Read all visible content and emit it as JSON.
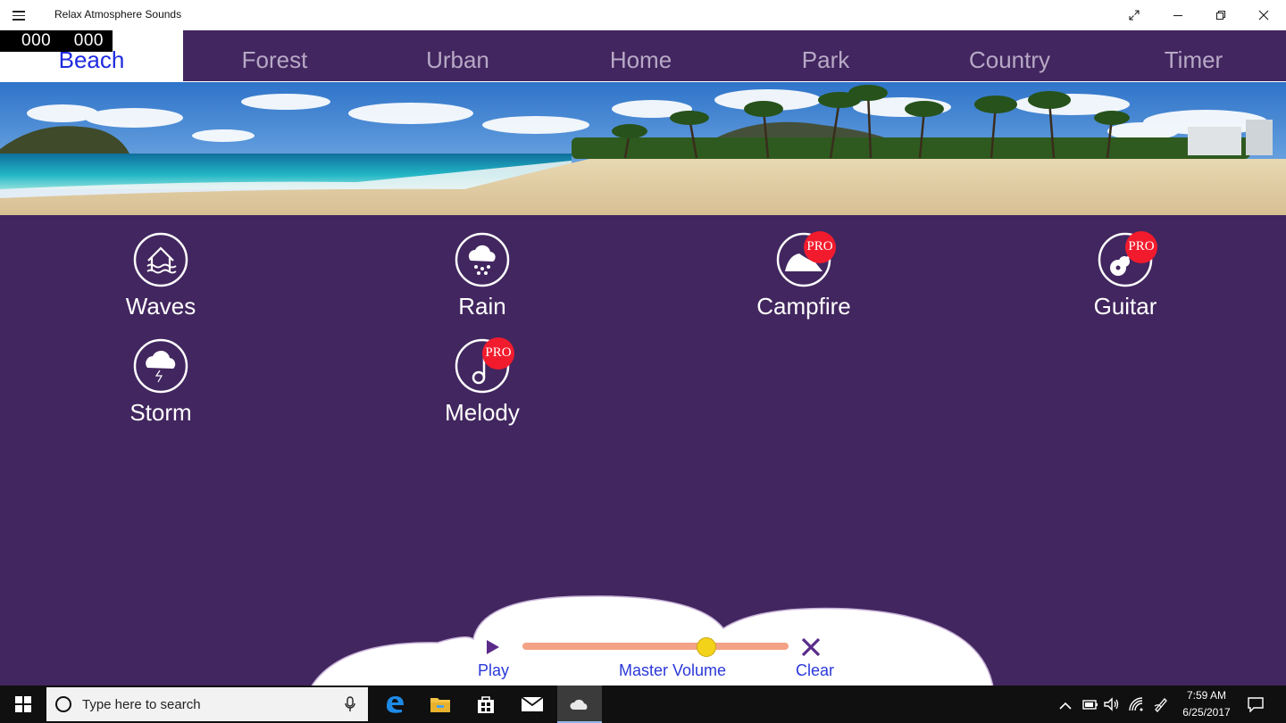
{
  "window": {
    "title": "Relax Atmosphere Sounds"
  },
  "counter": {
    "left": "000",
    "right": "000"
  },
  "tabs": [
    {
      "label": "Beach",
      "active": true
    },
    {
      "label": "Forest",
      "active": false
    },
    {
      "label": "Urban",
      "active": false
    },
    {
      "label": "Home",
      "active": false
    },
    {
      "label": "Park",
      "active": false
    },
    {
      "label": "Country",
      "active": false
    },
    {
      "label": "Timer",
      "active": false
    }
  ],
  "sounds": [
    {
      "label": "Waves",
      "icon": "waves-icon",
      "pro": false
    },
    {
      "label": "Rain",
      "icon": "rain-icon",
      "pro": false
    },
    {
      "label": "Campfire",
      "icon": "campfire-icon",
      "pro": true
    },
    {
      "label": "Guitar",
      "icon": "guitar-icon",
      "pro": true
    },
    {
      "label": "Storm",
      "icon": "storm-icon",
      "pro": false
    },
    {
      "label": "Melody",
      "icon": "music-note-icon",
      "pro": true
    }
  ],
  "pro_badge": "PRO",
  "controls": {
    "play_label": "Play",
    "volume_label": "Master Volume",
    "clear_label": "Clear",
    "volume_level": 0.69
  },
  "taskbar": {
    "search_placeholder": "Type here to search",
    "time": "7:59 AM",
    "date": "6/25/2017"
  },
  "colors": {
    "background": "#42265f",
    "active_tab_text": "#1f2adf",
    "inactive_tab_text": "#b7a9c6",
    "pro_badge": "#f21b2d",
    "control_text": "#2a38d8",
    "volume_track": "#f4a285",
    "volume_thumb": "#f3d21a"
  }
}
